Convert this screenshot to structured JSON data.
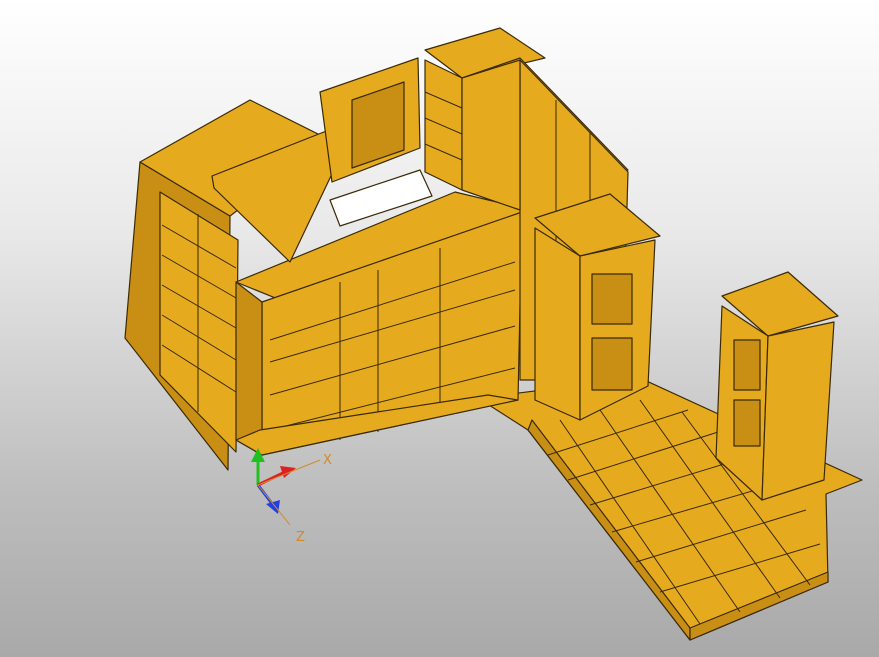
{
  "viewport": {
    "background_top": "#ffffff",
    "background_bottom": "#a9a9a9"
  },
  "model": {
    "fill_color": "#e6aa1e",
    "shade_color": "#c98f14",
    "edge_color": "#3a2a08"
  },
  "axes": {
    "x_label": "X",
    "z_label": "Z",
    "x_color": "#e02020",
    "y_color": "#20c020",
    "z_color": "#2040e0",
    "label_color": "#d08a2c"
  }
}
